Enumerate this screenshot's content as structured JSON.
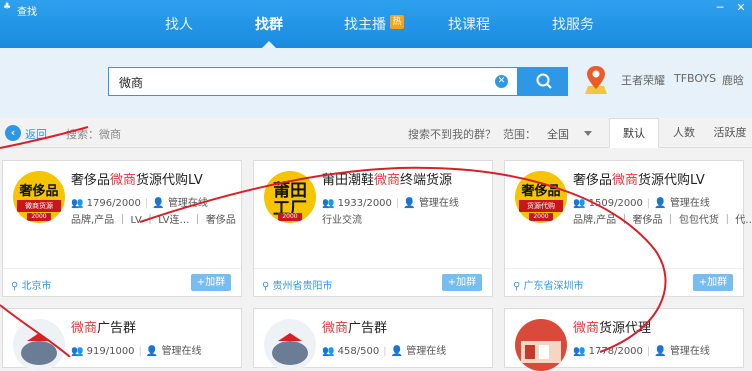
{
  "window": {
    "title": "查找",
    "logo_glyph": "♣",
    "minimize": "─",
    "close": "✕"
  },
  "nav": {
    "tabs": [
      "找人",
      "找群",
      "找主播",
      "找课程",
      "找服务"
    ],
    "active": "找群",
    "hot_badge": "热"
  },
  "search": {
    "value": "微商",
    "hot_words": [
      "王者荣耀",
      "TFBOYS",
      "鹿晗"
    ]
  },
  "filter": {
    "back_label": "返回",
    "searched_text": "搜索：微商",
    "not_found": "搜索不到我的群？",
    "range_label": "范围：",
    "range_value": "全国",
    "sort_tabs": [
      "默认",
      "人数",
      "活跃度"
    ]
  },
  "cards": [
    {
      "name_prefix": "奢侈品",
      "name_highlight": "微商",
      "name_suffix": "货源代购LV",
      "members": "1796/2000",
      "admin": "管理在线",
      "tags": "品牌,产品 ｜ LV ｜ LV连… ｜ 奢侈品",
      "city": "北京市",
      "join": "+加群",
      "avatar": {
        "line1": "奢侈品",
        "line2": "微商货源",
        "line3": "2000"
      }
    },
    {
      "name_prefix": "莆田潮鞋",
      "name_highlight": "微商",
      "name_suffix": "终端货源",
      "members": "1933/2000",
      "admin": "管理在线",
      "tags": "行业交流",
      "city": "贵州省贵阳市",
      "join": "+加群",
      "avatar": {
        "line1": "莆田",
        "line1b": "工厂",
        "line3": "2000"
      }
    },
    {
      "name_prefix": "奢侈品",
      "name_highlight": "微商",
      "name_suffix": "货源代购LV",
      "members": "1509/2000",
      "admin": "管理在线",
      "tags": "品牌,产品 ｜ 奢侈品 ｜ 包包代货 ｜ 代…",
      "city": "广东省深圳市",
      "join": "+加群",
      "avatar": {
        "line1": "奢侈品",
        "line2": "货源代购",
        "line3": "2000"
      }
    },
    {
      "name_prefix": "",
      "name_highlight": "微商",
      "name_suffix": "广告群",
      "members": "919/1000",
      "admin": "管理在线"
    },
    {
      "name_prefix": "",
      "name_highlight": "微商",
      "name_suffix": "广告群",
      "members": "458/500",
      "admin": "管理在线"
    },
    {
      "name_prefix": "",
      "name_highlight": "微商",
      "name_suffix": "货源代理",
      "members": "1778/2000",
      "admin": "管理在线"
    }
  ],
  "colors": {
    "accent": "#2e97e6",
    "highlight": "#e4393c",
    "scribble": "#d8202a",
    "avatar_gold": "#f6c400"
  }
}
